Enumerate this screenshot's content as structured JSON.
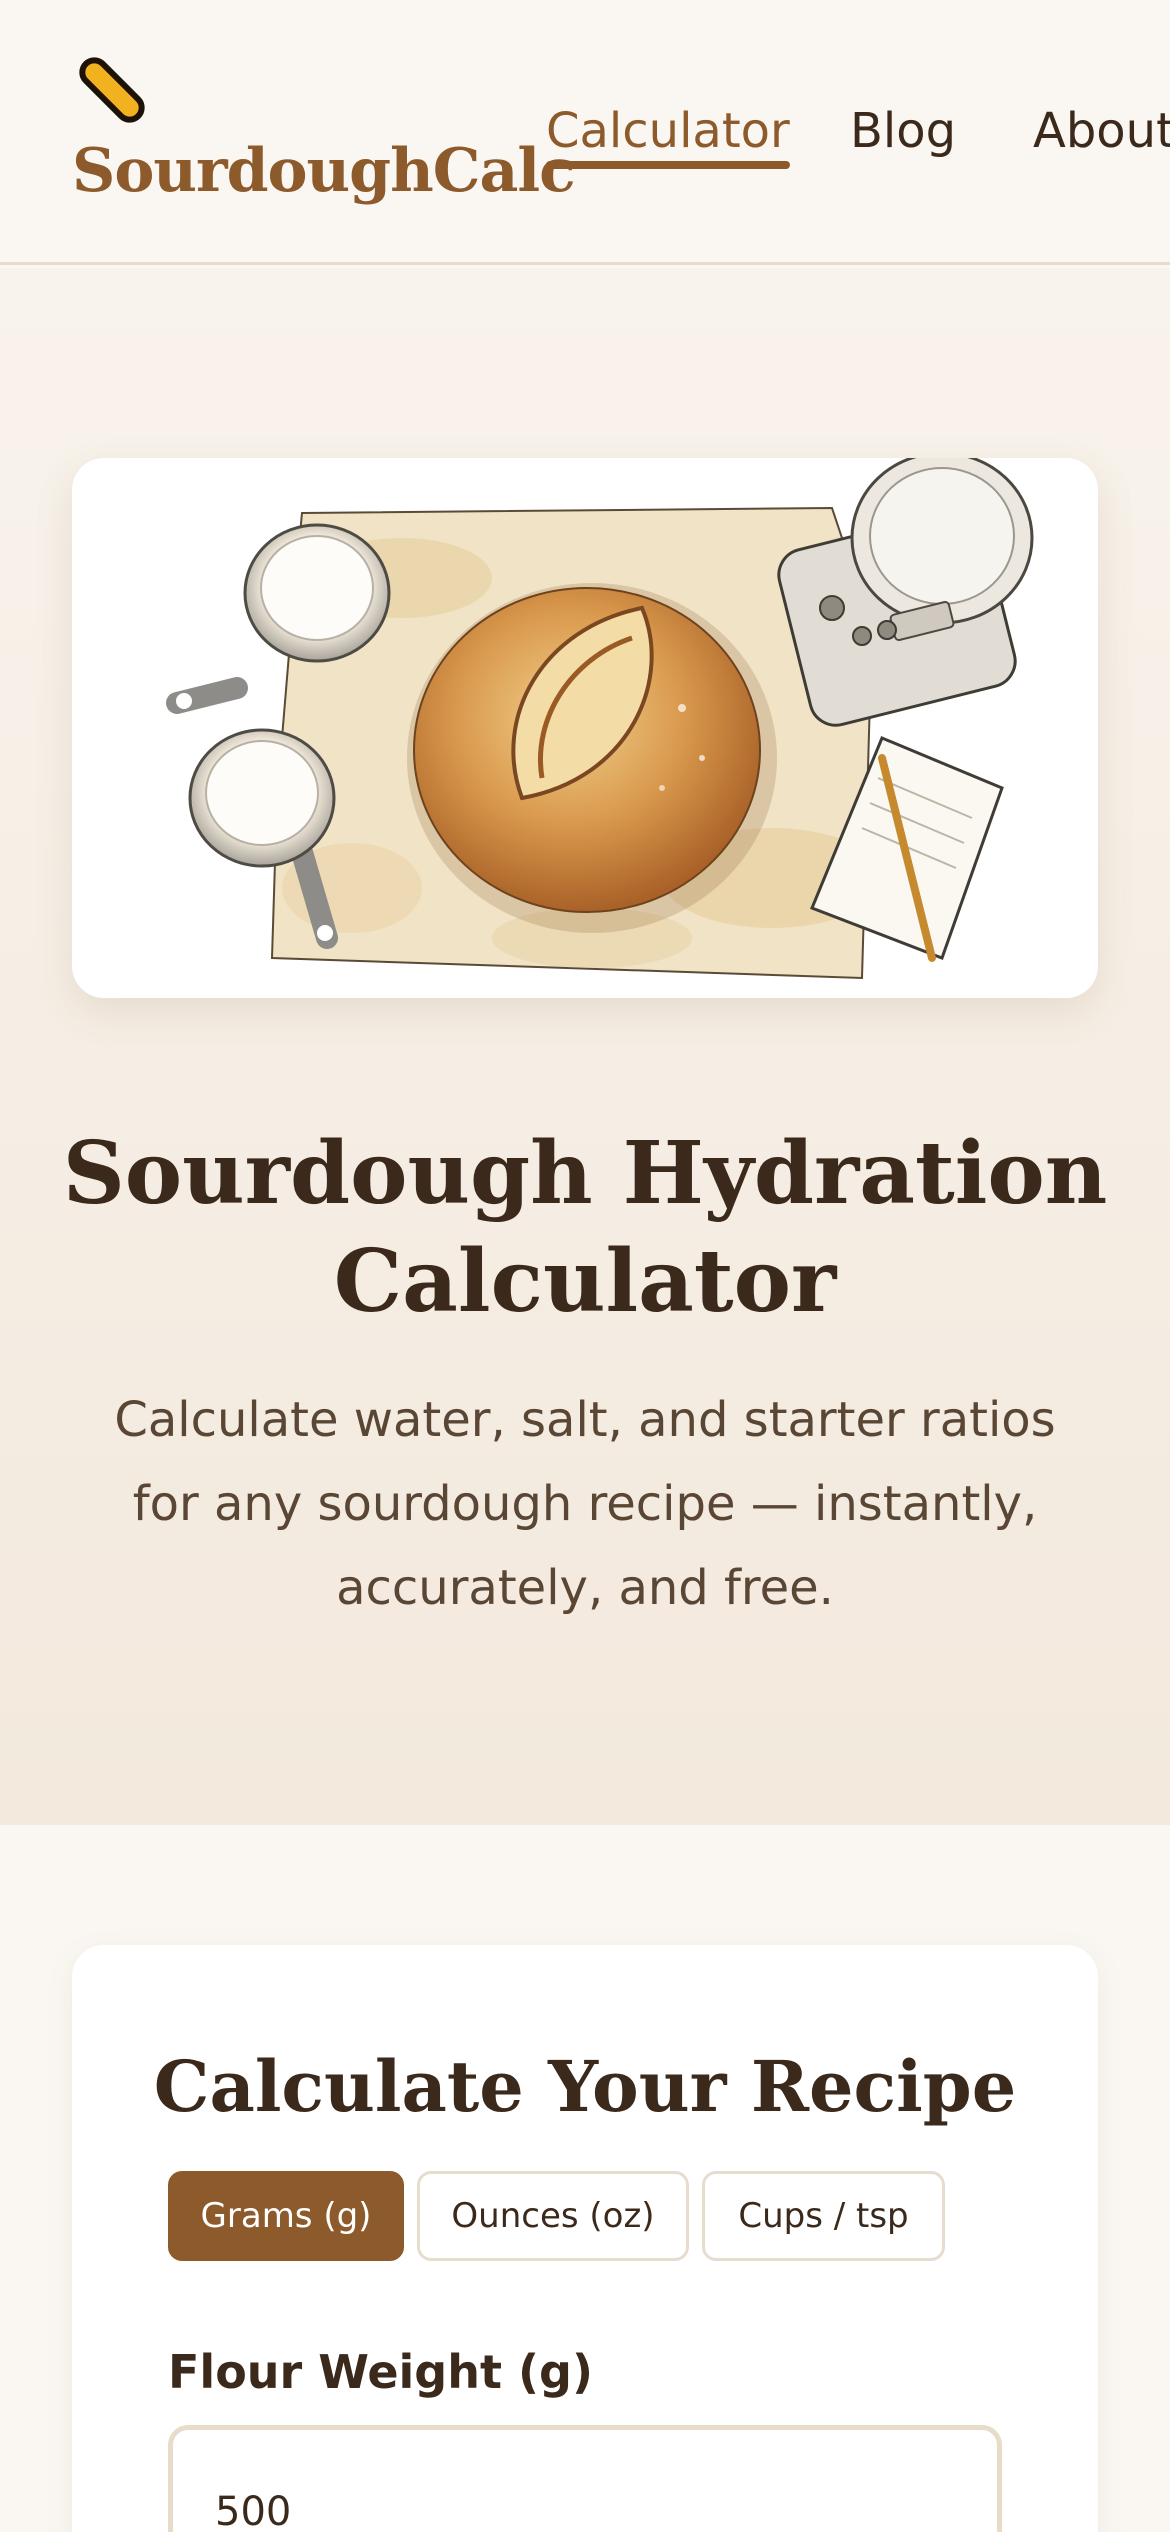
{
  "header": {
    "logo_text": "SourdoughCalc",
    "logo_icon": "rolling-pin-icon",
    "nav": [
      {
        "label": "Calculator",
        "active": true
      },
      {
        "label": "Blog",
        "active": false
      },
      {
        "label": "About",
        "active": false
      }
    ]
  },
  "hero": {
    "image": "watercolor illustration of sourdough loaf, flour measuring cups, kitchen scale and notebook",
    "title": "Sourdough Hydration Calculator",
    "subtitle": "Calculate water, salt, and starter ratios for any sourdough recipe — instantly, accurately, and free."
  },
  "calculator": {
    "title": "Calculate Your Recipe",
    "units": [
      {
        "label": "Grams (g)",
        "selected": true
      },
      {
        "label": "Ounces (oz)",
        "selected": false
      },
      {
        "label": "Cups / tsp",
        "selected": false
      }
    ],
    "flour_label": "Flour Weight (g)",
    "flour_value": "500"
  },
  "colors": {
    "accent": "#8c5a2b",
    "text": "#3b2a1c",
    "background": "#faf6f0"
  }
}
